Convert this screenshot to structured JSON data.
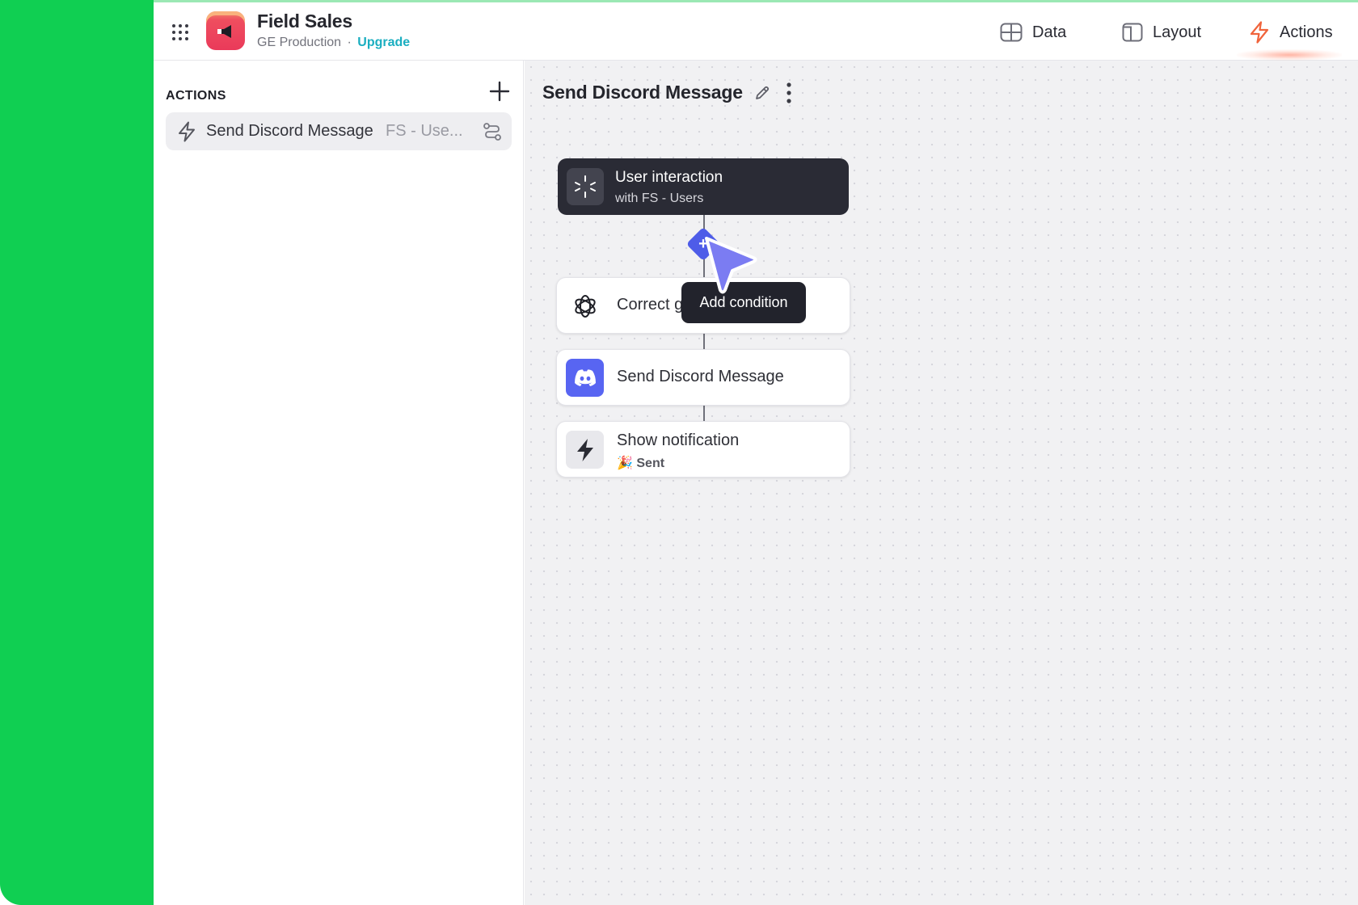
{
  "app": {
    "name": "Field Sales",
    "environment": "GE Production",
    "separator": "·",
    "upgrade_label": "Upgrade"
  },
  "nav": {
    "data_label": "Data",
    "layout_label": "Layout",
    "actions_label": "Actions",
    "active": "Actions",
    "active_color": "#f0643c"
  },
  "panel": {
    "title": "ACTIONS",
    "items": [
      {
        "name": "Send Discord Message",
        "scope": "FS - Use..."
      }
    ]
  },
  "canvas": {
    "title": "Send Discord Message",
    "trigger": {
      "title": "User interaction",
      "subtitle": "with FS - Users"
    },
    "steps": [
      {
        "label": "Correct g",
        "icon": "openai-icon"
      },
      {
        "label": "Send Discord Message",
        "icon": "discord-icon"
      },
      {
        "label": "Show notification",
        "sub": "🎉 Sent",
        "icon": "bolt-icon"
      }
    ],
    "tooltip": "Add condition"
  },
  "colors": {
    "frame_green": "#10cf52",
    "accent_blue": "#4e5ce8",
    "discord": "#5865f2",
    "upgrade": "#1aaec0",
    "trigger_bg": "#2a2b35"
  }
}
